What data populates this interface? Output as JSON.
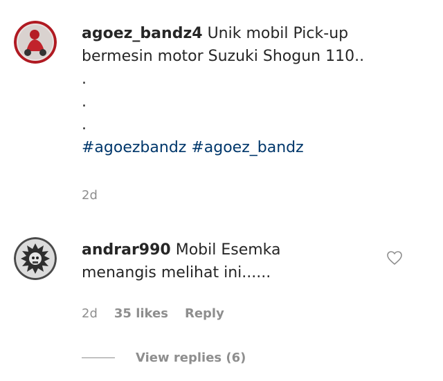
{
  "caption": {
    "username": "agoez_bandz4",
    "text_line1": "Unik mobil Pick-up",
    "text_line2": "bermesin motor Suzuki Shogun 110..",
    "dots": [
      ".",
      ".",
      "."
    ],
    "hashtags": "#agoezbandz #agoez_bandz",
    "time": "2d"
  },
  "comment": {
    "username": "andrar990",
    "text_line1": "Mobil Esemka",
    "text_line2": "menangis melihat ini......",
    "time": "2d",
    "likes": "35 likes",
    "reply_label": "Reply",
    "view_replies": "View replies (6)"
  },
  "colors": {
    "text": "#262626",
    "meta": "#8e8e8e",
    "hashtag": "#00376b"
  },
  "icons": {
    "caption_avatar": "avatar-motorcycle-rider",
    "comment_avatar": "avatar-skull",
    "like": "heart-outline-icon"
  }
}
